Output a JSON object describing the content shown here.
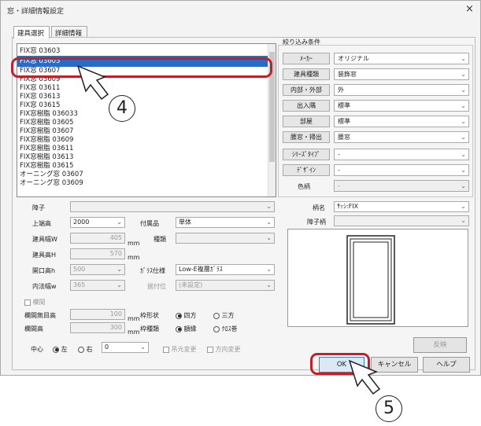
{
  "window": {
    "title": "窓・詳細情報設定",
    "close": "×"
  },
  "tabs": [
    {
      "label": "建具選択"
    },
    {
      "label": "詳細情報"
    }
  ],
  "list": {
    "items": [
      "FIX窓 03603",
      "FIX窓 03605",
      "FIX窓 03607",
      "FIX窓 03609",
      "FIX窓 03611",
      "FIX窓 03613",
      "FIX窓 03615",
      "FIX窓樹脂 036033",
      "FIX窓樹脂 03605",
      "FIX窓樹脂 03607",
      "FIX窓樹脂 03609",
      "FIX窓樹脂 03611",
      "FIX窓樹脂 03613",
      "FIX窓樹脂 03615",
      "オーニング窓 03607",
      "オーニング窓 03609"
    ],
    "selected_index": 1
  },
  "filter": {
    "title": "絞り込み条件",
    "rows": [
      {
        "label": "ﾒｰｶｰ",
        "value": "オリジナル",
        "disabled": false
      },
      {
        "label": "建具種類",
        "value": "装飾窓",
        "disabled": false
      },
      {
        "label": "内部・外部",
        "value": "外",
        "disabled": false
      },
      {
        "label": "出入隅",
        "value": "標準",
        "disabled": false
      },
      {
        "label": "部屋",
        "value": "標準",
        "disabled": false
      },
      {
        "label": "腰窓・掃出",
        "value": "腰窓",
        "disabled": false
      },
      {
        "label": "ｼﾘｰｽﾞﾀｲﾌﾟ",
        "value": "-",
        "disabled": false
      },
      {
        "label": "ﾃﾞｻﾞｲﾝ",
        "value": "-",
        "disabled": false
      },
      {
        "label": "色柄",
        "value": "-",
        "disabled": true
      }
    ]
  },
  "form": {
    "shoji_label": "障子",
    "uchinori_label": "上端高",
    "uchinori_value": "2000",
    "fuzoku_label": "付属品",
    "fuzoku_value": "単体",
    "tategu_w_label": "建具幅W",
    "tategu_w_value": "405",
    "mm1": "mm",
    "shurui_label": "種類",
    "tategu_h_label": "建具高H",
    "tategu_h_value": "570",
    "mm2": "mm",
    "kaiko_h_label": "開口高h",
    "kaiko_h_value": "500",
    "glass_label": "ｶﾞﾗｽ仕様",
    "glass_value": "Low-E複層ｶﾞﾗｽ",
    "uchinori_w_label": "内法幅w",
    "uchinori_w_value": "365",
    "tsuke_label": "据付位",
    "tsuke_value": "(未設定)",
    "rankan_label": "欄間",
    "rankan_muzai_label": "欄間無目高",
    "rankan_muzai_value": "100",
    "mm3": "mm",
    "rankan_h_label": "欄間高",
    "rankan_h_value": "300",
    "mm4": "mm",
    "wakukei_label": "枠形状",
    "wakukei_opt1": "四方",
    "wakukei_opt2": "三方",
    "wakushu_label": "枠種類",
    "wakushu_opt1": "額縁",
    "wakushu_opt2": "ｸﾛｽ巻",
    "center_label": "中心",
    "center_opt1": "左",
    "center_opt2": "右",
    "center_value": "0",
    "hanten_label": "吊元変更",
    "houkou_label": "方向変更"
  },
  "right": {
    "gara_label": "柄名",
    "gara_value": "ｻｯｼ:FIX",
    "shoji_gara_label": "障子柄",
    "reflect_label": "反映"
  },
  "buttons": {
    "ok": "OK",
    "cancel": "キャンセル",
    "help": "ヘルプ"
  },
  "callouts": {
    "a": "4",
    "b": "5"
  },
  "colors": {
    "highlight": "#c0202a",
    "selection": "#2a6bc7"
  }
}
